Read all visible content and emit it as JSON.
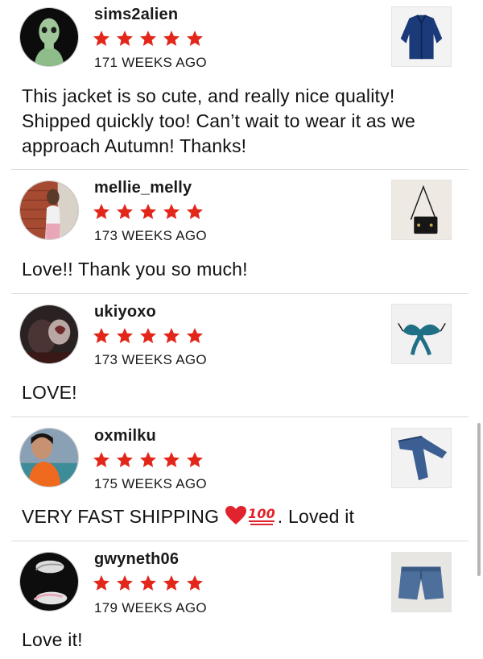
{
  "colors": {
    "star": "#e3261a",
    "divider": "#d9d9d9",
    "text": "#111111",
    "scrollbar": "#b5b5b5"
  },
  "reviews": [
    {
      "username": "sims2alien",
      "rating": 5,
      "timestamp": "171 WEEKS AGO",
      "text": "This jacket is so cute, and really nice quality! Shipped quickly too! Can’t wait to wear it as we approach Autumn! Thanks!",
      "avatar_icon": "alien-avatar",
      "thumbnail_icon": "blue-jacket-photo"
    },
    {
      "username": "mellie_melly",
      "rating": 5,
      "timestamp": "173 WEEKS AGO",
      "text": "Love!! Thank you so much!",
      "avatar_icon": "person-brick-wall-avatar",
      "thumbnail_icon": "black-handbag-photo"
    },
    {
      "username": "ukiyoxo",
      "rating": 5,
      "timestamp": "173 WEEKS AGO",
      "text": "LOVE!",
      "avatar_icon": "dark-portrait-avatar",
      "thumbnail_icon": "teal-bra-photo"
    },
    {
      "username": "oxmilku",
      "rating": 5,
      "timestamp": "175 WEEKS AGO",
      "text_before": "VERY FAST SHIPPING ",
      "text_after": ". Loved it",
      "emojis": [
        "red-heart-emoji",
        "hundred-points-emoji"
      ],
      "avatar_icon": "person-orange-top-avatar",
      "thumbnail_icon": "jeans-photo"
    },
    {
      "username": "gwyneth06",
      "rating": 5,
      "timestamp": "179 WEEKS AGO",
      "text": "Love it!",
      "avatar_icon": "sneakers-avatar",
      "thumbnail_icon": "denim-shorts-photo"
    }
  ]
}
